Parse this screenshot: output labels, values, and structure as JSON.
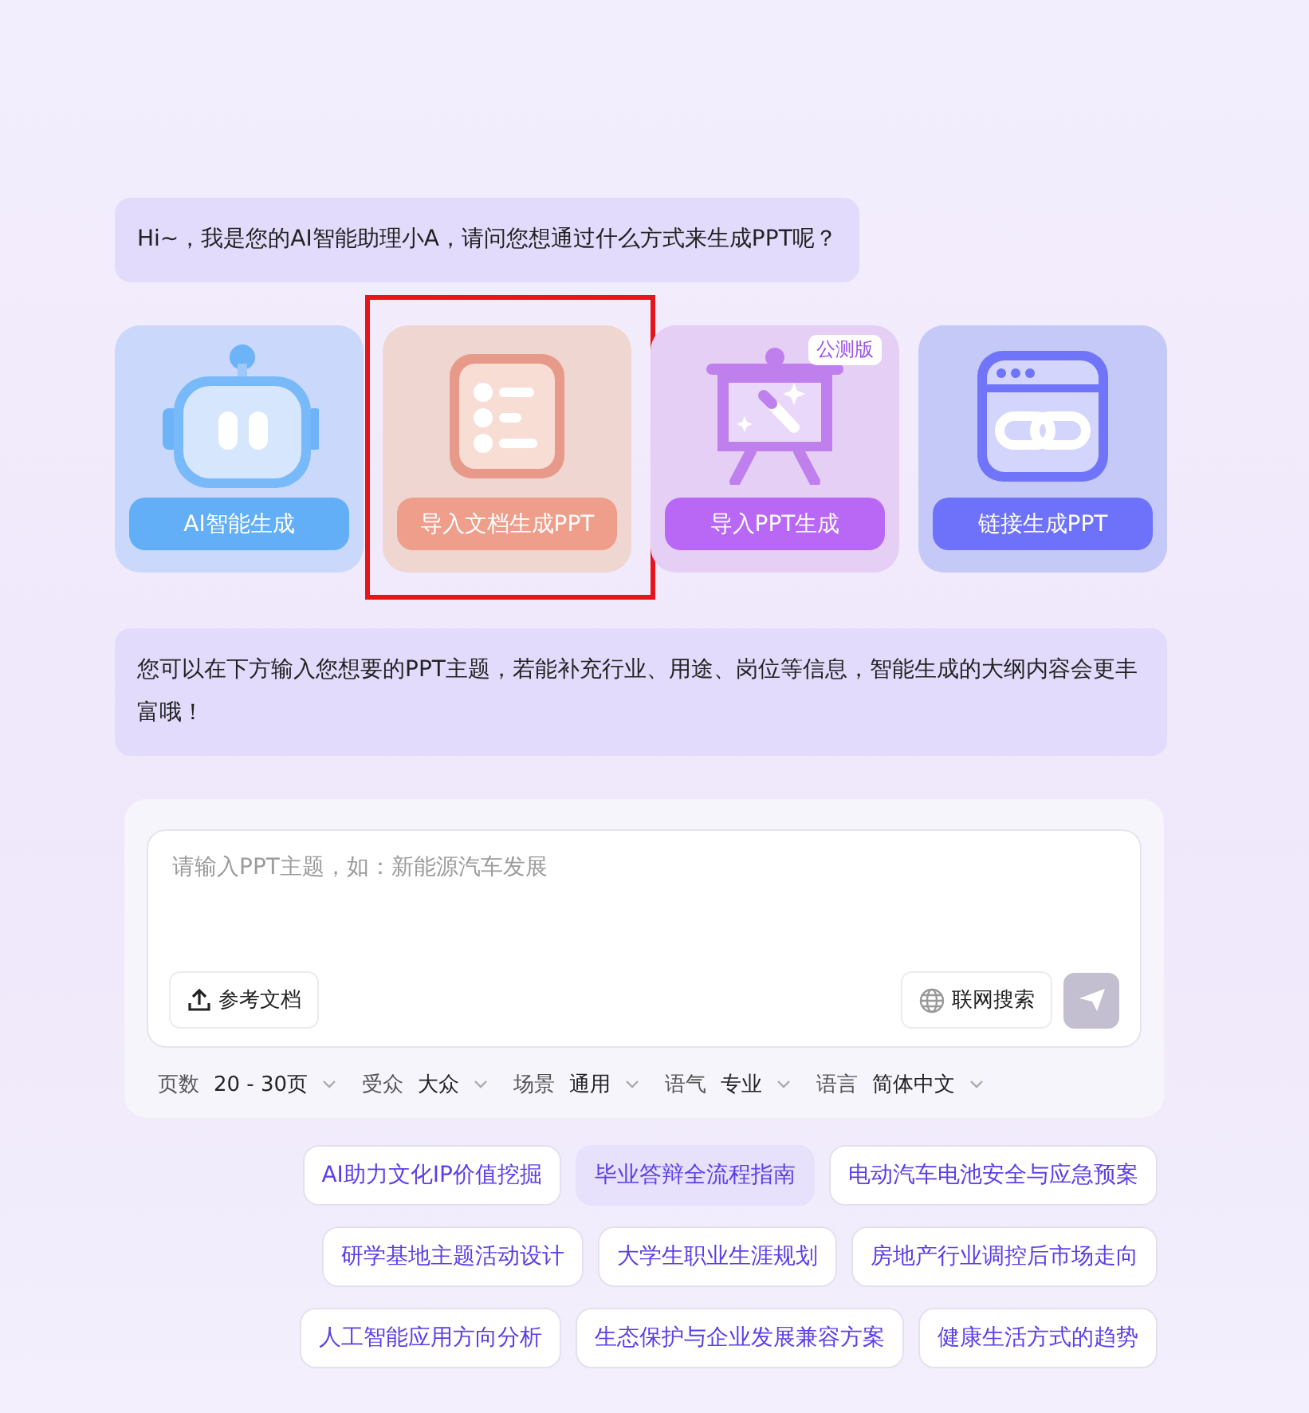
{
  "greeting": "Hi~，我是您的AI智能助理小A，请问您想通过什么方式来生成PPT呢？",
  "modes": [
    {
      "kind": "robot",
      "label": "AI智能生成",
      "color": "#62aef7",
      "highlighted": false
    },
    {
      "kind": "document",
      "label": "导入文档生成PPT",
      "color": "#ee9e8a",
      "highlighted": true
    },
    {
      "kind": "presentation",
      "label": "导入PPT生成",
      "color": "#b968f5",
      "highlighted": false,
      "badge": "公测版"
    },
    {
      "kind": "link",
      "label": "链接生成PPT",
      "color": "#6e72fb",
      "highlighted": false
    }
  ],
  "hint": "您可以在下方输入您想要的PPT主题，若能补充行业、用途、岗位等信息，智能生成的大纲内容会更丰富哦！",
  "composer": {
    "placeholder": "请输入PPT主题，如：新能源汽车发展",
    "upload_label": "参考文档",
    "web_search_label": "联网搜索",
    "web_search_on": false
  },
  "options": [
    {
      "label": "页数",
      "value": "20 - 30页"
    },
    {
      "label": "受众",
      "value": "大众"
    },
    {
      "label": "场景",
      "value": "通用"
    },
    {
      "label": "语气",
      "value": "专业"
    },
    {
      "label": "语言",
      "value": "简体中文"
    }
  ],
  "suggestions": [
    [
      {
        "text": "AI助力文化IP价值挖掘",
        "selected": false
      },
      {
        "text": "毕业答辩全流程指南",
        "selected": true
      },
      {
        "text": "电动汽车电池安全与应急预案",
        "selected": false
      }
    ],
    [
      {
        "text": "研学基地主题活动设计",
        "selected": false
      },
      {
        "text": "大学生职业生涯规划",
        "selected": false
      },
      {
        "text": "房地产行业调控后市场走向",
        "selected": false
      }
    ],
    [
      {
        "text": "人工智能应用方向分析",
        "selected": false
      },
      {
        "text": "生态保护与企业发展兼容方案",
        "selected": false
      },
      {
        "text": "健康生活方式的趋势",
        "selected": false
      }
    ]
  ]
}
